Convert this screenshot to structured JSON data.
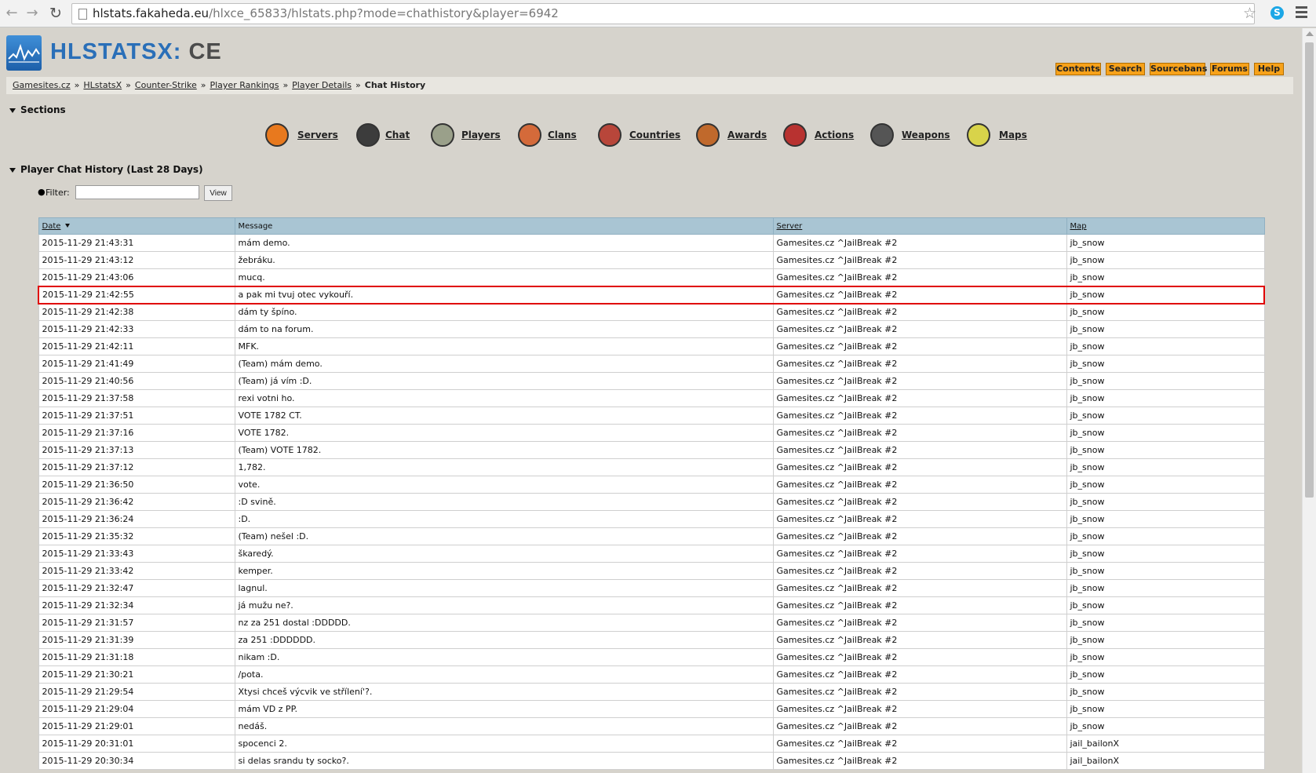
{
  "browser": {
    "url_host": "hlstats.fakaheda.eu",
    "url_path": "/hlxce_65833/hlstats.php?mode=chathistory&player=6942",
    "icons": [
      "back-icon",
      "forward-icon",
      "reload-icon",
      "star-icon",
      "skype-icon",
      "menu-icon"
    ]
  },
  "header": {
    "logo_main": "HLSTATSX:",
    "logo_suffix": "CE",
    "links": [
      "Contents",
      "Search",
      "Sourcebans",
      "Forums",
      "Help"
    ]
  },
  "breadcrumb": {
    "items": [
      "Gamesites.cz",
      "HLstatsX",
      "Counter-Strike",
      "Player Rankings",
      "Player Details"
    ],
    "separator": "»",
    "current": "Chat History"
  },
  "sections": {
    "title": "Sections",
    "items": [
      {
        "label": "Servers",
        "icon": "servers-icon",
        "color": "#e8791e"
      },
      {
        "label": "Chat",
        "icon": "chat-icon",
        "color": "#3c3c3c"
      },
      {
        "label": "Players",
        "icon": "players-icon",
        "color": "#9aa08a"
      },
      {
        "label": "Clans",
        "icon": "clans-icon",
        "color": "#d46a3a"
      },
      {
        "label": "Countries",
        "icon": "countries-icon",
        "color": "#b8463a"
      },
      {
        "label": "Awards",
        "icon": "awards-icon",
        "color": "#c0692c"
      },
      {
        "label": "Actions",
        "icon": "actions-icon",
        "color": "#b83230"
      },
      {
        "label": "Weapons",
        "icon": "weapons-icon",
        "color": "#555555"
      },
      {
        "label": "Maps",
        "icon": "maps-icon",
        "color": "#d8d34a"
      }
    ]
  },
  "chat_history": {
    "title": "Player Chat History (Last 28 Days)",
    "filter_label": "Filter:",
    "filter_value": "",
    "view_button": "View",
    "columns": [
      "Date",
      "Message",
      "Server",
      "Map"
    ],
    "highlight_index": 3,
    "rows": [
      [
        "2015-11-29 21:43:31",
        "mám demo.",
        "Gamesites.cz ^JailBreak #2",
        "jb_snow"
      ],
      [
        "2015-11-29 21:43:12",
        "žebráku.",
        "Gamesites.cz ^JailBreak #2",
        "jb_snow"
      ],
      [
        "2015-11-29 21:43:06",
        "mucq.",
        "Gamesites.cz ^JailBreak #2",
        "jb_snow"
      ],
      [
        "2015-11-29 21:42:55",
        "a pak mi tvuj otec vykouří.",
        "Gamesites.cz ^JailBreak #2",
        "jb_snow"
      ],
      [
        "2015-11-29 21:42:38",
        "dám ty špíno.",
        "Gamesites.cz ^JailBreak #2",
        "jb_snow"
      ],
      [
        "2015-11-29 21:42:33",
        "dám to na forum.",
        "Gamesites.cz ^JailBreak #2",
        "jb_snow"
      ],
      [
        "2015-11-29 21:42:11",
        "MFK.",
        "Gamesites.cz ^JailBreak #2",
        "jb_snow"
      ],
      [
        "2015-11-29 21:41:49",
        "(Team) mám demo.",
        "Gamesites.cz ^JailBreak #2",
        "jb_snow"
      ],
      [
        "2015-11-29 21:40:56",
        "(Team) já vím :D.",
        "Gamesites.cz ^JailBreak #2",
        "jb_snow"
      ],
      [
        "2015-11-29 21:37:58",
        "rexi votni ho.",
        "Gamesites.cz ^JailBreak #2",
        "jb_snow"
      ],
      [
        "2015-11-29 21:37:51",
        "VOTE 1782 CT.",
        "Gamesites.cz ^JailBreak #2",
        "jb_snow"
      ],
      [
        "2015-11-29 21:37:16",
        "VOTE 1782.",
        "Gamesites.cz ^JailBreak #2",
        "jb_snow"
      ],
      [
        "2015-11-29 21:37:13",
        "(Team) VOTE 1782.",
        "Gamesites.cz ^JailBreak #2",
        "jb_snow"
      ],
      [
        "2015-11-29 21:37:12",
        "1,782.",
        "Gamesites.cz ^JailBreak #2",
        "jb_snow"
      ],
      [
        "2015-11-29 21:36:50",
        "vote.",
        "Gamesites.cz ^JailBreak #2",
        "jb_snow"
      ],
      [
        "2015-11-29 21:36:42",
        ":D svině.",
        "Gamesites.cz ^JailBreak #2",
        "jb_snow"
      ],
      [
        "2015-11-29 21:36:24",
        ":D.",
        "Gamesites.cz ^JailBreak #2",
        "jb_snow"
      ],
      [
        "2015-11-29 21:35:32",
        "(Team) nešel :D.",
        "Gamesites.cz ^JailBreak #2",
        "jb_snow"
      ],
      [
        "2015-11-29 21:33:43",
        "škaredý.",
        "Gamesites.cz ^JailBreak #2",
        "jb_snow"
      ],
      [
        "2015-11-29 21:33:42",
        "kemper.",
        "Gamesites.cz ^JailBreak #2",
        "jb_snow"
      ],
      [
        "2015-11-29 21:32:47",
        "lagnul.",
        "Gamesites.cz ^JailBreak #2",
        "jb_snow"
      ],
      [
        "2015-11-29 21:32:34",
        "já mužu ne?.",
        "Gamesites.cz ^JailBreak #2",
        "jb_snow"
      ],
      [
        "2015-11-29 21:31:57",
        "nz za 251 dostal :DDDDD.",
        "Gamesites.cz ^JailBreak #2",
        "jb_snow"
      ],
      [
        "2015-11-29 21:31:39",
        "za 251 :DDDDDD.",
        "Gamesites.cz ^JailBreak #2",
        "jb_snow"
      ],
      [
        "2015-11-29 21:31:18",
        "nikam :D.",
        "Gamesites.cz ^JailBreak #2",
        "jb_snow"
      ],
      [
        "2015-11-29 21:30:21",
        "/pota.",
        "Gamesites.cz ^JailBreak #2",
        "jb_snow"
      ],
      [
        "2015-11-29 21:29:54",
        "Xtysi chceš výcvik ve střílení'?.",
        "Gamesites.cz ^JailBreak #2",
        "jb_snow"
      ],
      [
        "2015-11-29 21:29:04",
        "mám VD z PP.",
        "Gamesites.cz ^JailBreak #2",
        "jb_snow"
      ],
      [
        "2015-11-29 21:29:01",
        "nedáš.",
        "Gamesites.cz ^JailBreak #2",
        "jb_snow"
      ],
      [
        "2015-11-29 20:31:01",
        "spocenci 2.",
        "Gamesites.cz ^JailBreak #2",
        "jail_bailonX"
      ],
      [
        "2015-11-29 20:30:34",
        "si delas srandu ty socko?.",
        "Gamesites.cz ^JailBreak #2",
        "jail_bailonX"
      ]
    ]
  }
}
